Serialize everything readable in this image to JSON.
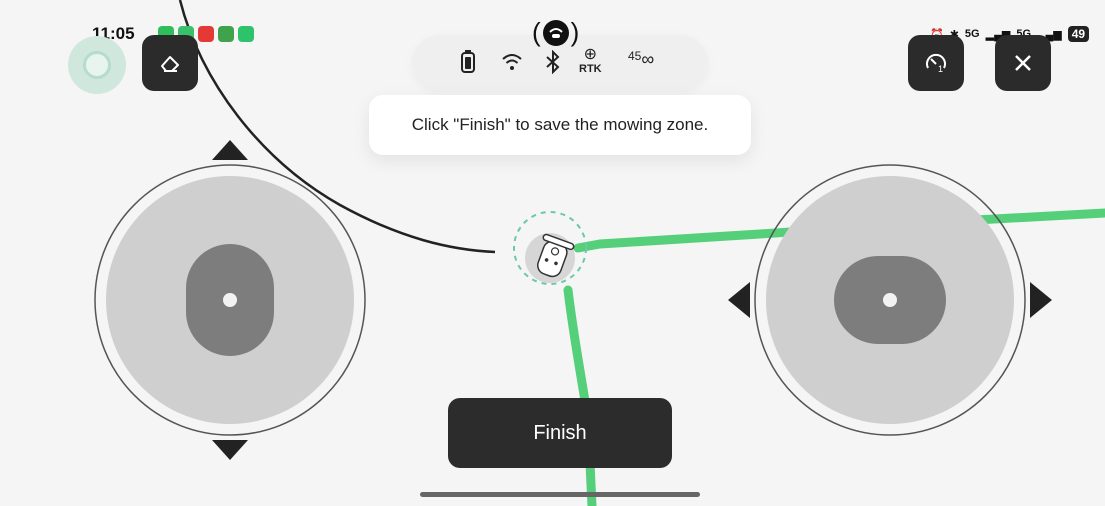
{
  "status_bar": {
    "time": "11:05",
    "battery": "49",
    "signal_1": "5G",
    "signal_2": "5G"
  },
  "top_controls": {
    "eraser_icon": "eraser-icon",
    "speed_icon": "speedometer-icon",
    "speed_level": "1",
    "close_icon": "close-icon"
  },
  "connectivity": {
    "icons": [
      "battery-icon",
      "wifi-icon",
      "bluetooth-icon",
      "rtk-icon",
      "link-icon"
    ],
    "rtk_label": "RTK",
    "link_count": "45"
  },
  "tooltip": {
    "message": "Click \"Finish\" to save the mowing zone."
  },
  "finish_button": {
    "label": "Finish"
  },
  "colors": {
    "path_green": "#55cf7a",
    "boundary_black": "#222222",
    "button_dark": "#2c2c2c"
  }
}
